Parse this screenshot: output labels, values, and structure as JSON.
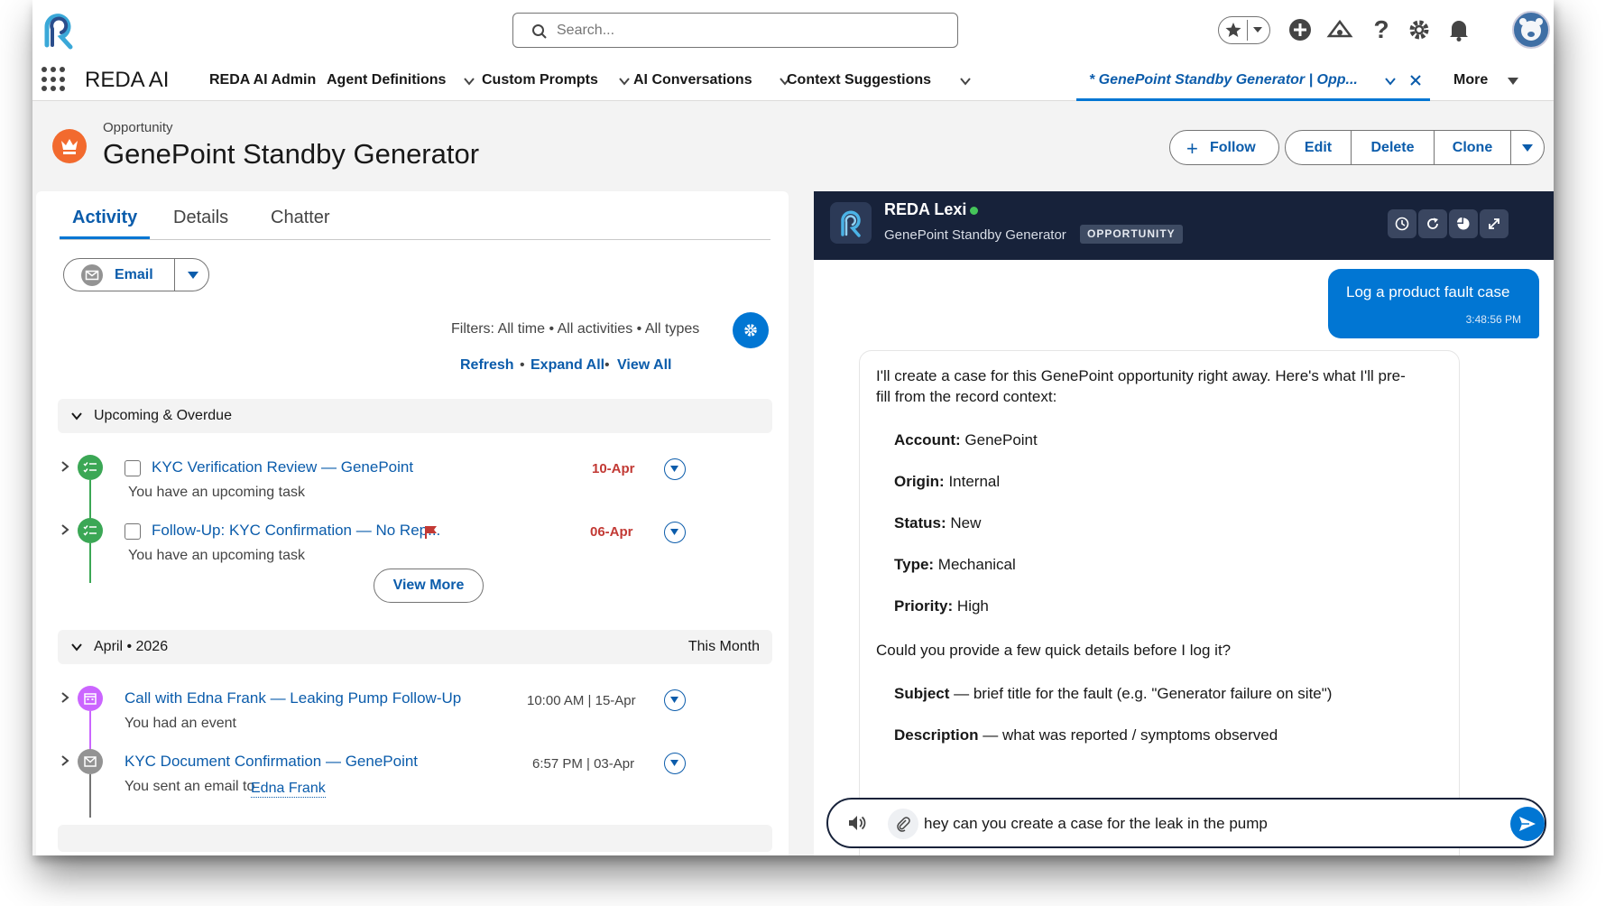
{
  "header": {
    "search_placeholder": "Search..."
  },
  "nav": {
    "app_name": "REDA AI",
    "items": [
      {
        "label": "REDA AI Admin"
      },
      {
        "label": "Agent Definitions"
      },
      {
        "label": "Custom Prompts"
      },
      {
        "label": "AI Conversations"
      },
      {
        "label": "Context Suggestions"
      }
    ],
    "active_tab": "* GenePoint Standby Generator | Opp...",
    "more": "More"
  },
  "record": {
    "object_type": "Opportunity",
    "title": "GenePoint Standby Generator",
    "buttons": {
      "follow": "Follow",
      "edit": "Edit",
      "delete": "Delete",
      "clone": "Clone"
    }
  },
  "activity": {
    "tabs": [
      "Activity",
      "Details",
      "Chatter"
    ],
    "email_button": "Email",
    "filters": "Filters: All time • All activities • All types",
    "links": {
      "refresh": "Refresh",
      "expand_all": "Expand All",
      "view_all": "View All"
    },
    "upcoming": {
      "label": "Upcoming & Overdue",
      "items": [
        {
          "title": "KYC Verification Review — GenePoint",
          "subtitle": "You have an upcoming task",
          "date": "10-Apr"
        },
        {
          "title": "Follow-Up: KYC Confirmation — No Rep...",
          "subtitle": "You have an upcoming task",
          "date": "06-Apr"
        }
      ],
      "view_more": "View More"
    },
    "month": {
      "label": "April • 2026",
      "right_label": "This Month",
      "items": [
        {
          "title": "Call with Edna Frank — Leaking Pump Follow-Up",
          "subtitle": "You had an event",
          "date": "10:00 AM | 15-Apr"
        },
        {
          "title": "KYC Document Confirmation — GenePoint",
          "subtitle": "You sent an email to",
          "link": "Edna Frank",
          "date": "6:57 PM | 03-Apr"
        }
      ]
    }
  },
  "chat": {
    "agent_name": "REDA Lexi",
    "context_record": "GenePoint Standby Generator",
    "context_badge": "OPPORTUNITY",
    "user_message": {
      "text": "Log a product fault case",
      "time": "3:48:56 PM"
    },
    "bot_message": {
      "intro_line1": "I'll create a case for this GenePoint opportunity right away. Here's what I'll pre-",
      "intro_line2": "fill from the record context:",
      "fields": [
        {
          "label": "Account:",
          "value": " GenePoint"
        },
        {
          "label": "Origin:",
          "value": " Internal"
        },
        {
          "label": "Status:",
          "value": " New"
        },
        {
          "label": "Type:",
          "value": " Mechanical"
        },
        {
          "label": "Priority:",
          "value": " High"
        }
      ],
      "question": "Could you provide a few quick details before I log it?",
      "details": [
        {
          "label": "Subject",
          "value": " — brief title for the fault (e.g. \"Generator failure on site\")"
        },
        {
          "label": "Description",
          "value": " — what was reported / symptoms observed"
        }
      ]
    },
    "input_value": "hey can you create a case for the leak in the pump"
  },
  "colors": {
    "brand": "#0176d3",
    "chat_header": "#17223a",
    "overdue": "#c23934",
    "task": "#3ba755",
    "event": "#cb65ff",
    "email": "#939393"
  }
}
